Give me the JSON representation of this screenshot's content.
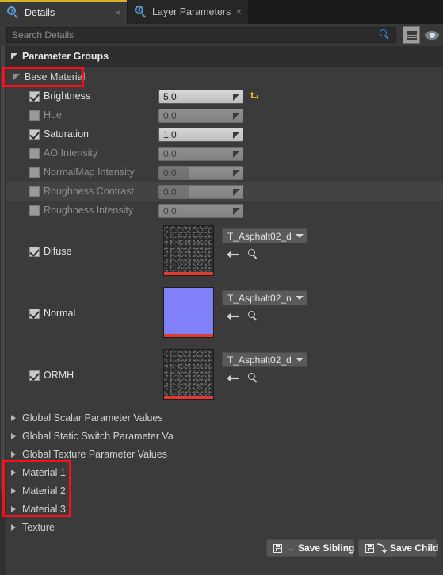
{
  "window": {
    "accent_yellow": "#d9b22c",
    "annotation_color": "#fb0d1b",
    "panel_bg": "#3b3b3b"
  },
  "tabs": [
    {
      "label": "Details",
      "icon": "details-info-search-icon",
      "close": "×",
      "active": true
    },
    {
      "label": "Layer Parameters",
      "icon": "details-info-search-icon",
      "close": "×",
      "active": false
    }
  ],
  "search": {
    "placeholder": "Search Details",
    "value": "",
    "search_icon": "magnifier-icon",
    "grid_icon": "grid-view-icon",
    "eye_icon": "eye-visibility-icon"
  },
  "groups": {
    "root_label": "Parameter Groups",
    "base_material_label": "Base Material"
  },
  "scalars": [
    {
      "label": "Brightness",
      "checked": true,
      "value": "5.0",
      "fill_pct": 0,
      "reset": true
    },
    {
      "label": "Hue",
      "checked": false,
      "value": "0.0",
      "fill_pct": 0,
      "reset": false
    },
    {
      "label": "Saturation",
      "checked": true,
      "value": "1.0",
      "fill_pct": 0,
      "reset": false
    },
    {
      "label": "AO Intensity",
      "checked": false,
      "value": "0.0",
      "fill_pct": 0,
      "reset": false
    },
    {
      "label": "NormalMap Intensity",
      "checked": false,
      "value": "0.0",
      "fill_pct": 36,
      "reset": false
    },
    {
      "label": "Roughness Contrast",
      "checked": false,
      "value": "0.0",
      "fill_pct": 36,
      "reset": false
    },
    {
      "label": "Roughness Intensity",
      "checked": false,
      "value": "0.0",
      "fill_pct": 0,
      "reset": false
    }
  ],
  "textures": [
    {
      "label": "Difuse",
      "checked": true,
      "asset": "T_Asphalt02_d",
      "kind": "asphalt",
      "back_icon": "back-arrow-icon",
      "find_icon": "browse-magnifier-icon"
    },
    {
      "label": "Normal",
      "checked": true,
      "asset": "T_Asphalt02_n",
      "kind": "normal",
      "back_icon": "back-arrow-icon",
      "find_icon": "browse-magnifier-icon"
    },
    {
      "label": "ORMH",
      "checked": true,
      "asset": "T_Asphalt02_d",
      "kind": "asphalt",
      "back_icon": "back-arrow-icon",
      "find_icon": "browse-magnifier-icon"
    }
  ],
  "collapsed_groups": [
    {
      "label": "Global Scalar Parameter Values",
      "highlighted": false
    },
    {
      "label": "Global Static Switch Parameter Va",
      "highlighted": false
    },
    {
      "label": "Global Texture Parameter Values",
      "highlighted": false
    },
    {
      "label": "Material 1",
      "highlighted": true
    },
    {
      "label": "Material 2",
      "highlighted": true
    },
    {
      "label": "Material 3",
      "highlighted": true
    },
    {
      "label": "Texture",
      "highlighted": false
    }
  ],
  "footer": {
    "save_sibling": "Save Sibling",
    "save_child": "Save Child",
    "sibling_arrow": "→",
    "child_arrow": "⤵"
  }
}
